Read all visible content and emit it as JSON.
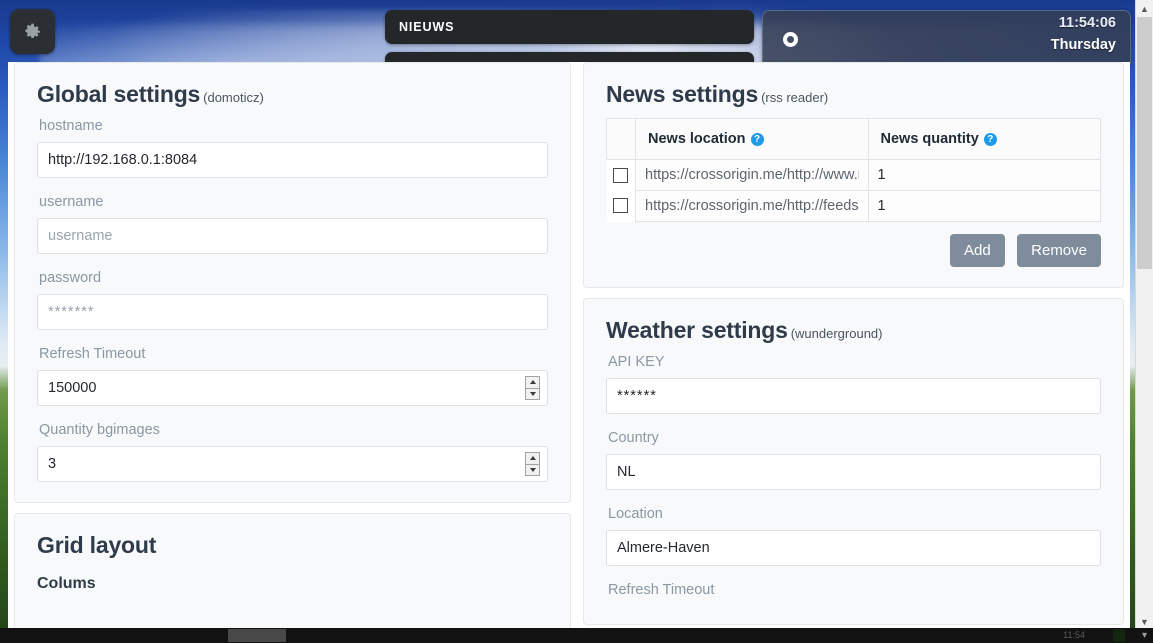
{
  "desktop": {
    "gear_icon": "gear-icon",
    "news_tile_label": "NIEUWS",
    "clock": {
      "icon": "circle-ring-icon",
      "time": "11:54:06",
      "day": "Thursday"
    }
  },
  "global_settings": {
    "title": "Global settings",
    "subtitle": "(domoticz)",
    "fields": {
      "hostname_label": "hostname",
      "hostname_value": "http://192.168.0.1:8084",
      "username_label": "username",
      "username_value": "",
      "username_placeholder": "username",
      "password_label": "password",
      "password_value": "",
      "password_placeholder": "*******",
      "refresh_timeout_label": "Refresh Timeout",
      "refresh_timeout_value": "150000",
      "quantity_bgimages_label": "Quantity bgimages",
      "quantity_bgimages_value": "3"
    }
  },
  "grid_layout": {
    "title": "Grid layout",
    "columns_label": "Colums"
  },
  "news_settings": {
    "title": "News settings",
    "subtitle": "(rss reader)",
    "columns": [
      "News location",
      "News quantity"
    ],
    "help_glyph": "?",
    "rows": [
      {
        "checked": false,
        "location": "https://crossorigin.me/http://www.r",
        "quantity": "1"
      },
      {
        "checked": false,
        "location": "https://crossorigin.me/http://feeds.",
        "quantity": "1"
      }
    ],
    "add_label": "Add",
    "remove_label": "Remove"
  },
  "weather_settings": {
    "title": "Weather settings",
    "subtitle": "(wunderground)",
    "fields": {
      "api_key_label": "API KEY",
      "api_key_value": "******",
      "country_label": "Country",
      "country_value": "NL",
      "location_label": "Location",
      "location_value": "Almere-Haven",
      "refresh_timeout_label": "Refresh Timeout"
    }
  },
  "taskbar": {
    "clock": "11:54"
  },
  "colors": {
    "accent_help": "#1e9ae8",
    "button": "#7f8c9b",
    "label": "#8a97a5",
    "heading": "#2f3b4a"
  }
}
